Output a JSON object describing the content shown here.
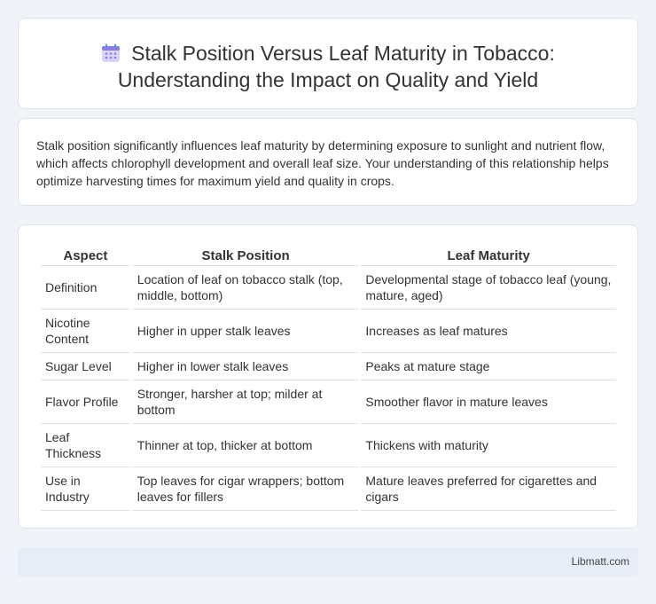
{
  "header": {
    "icon": "calendar-icon",
    "title_line1": "Stalk Position Versus Leaf Maturity in Tobacco:",
    "title_line2": "Understanding the Impact on Quality and Yield"
  },
  "intro": {
    "text": "Stalk position significantly influences leaf maturity by determining exposure to sunlight and nutrient flow, which affects chlorophyll development and overall leaf size. Your understanding of this relationship helps optimize harvesting times for maximum yield and quality in crops."
  },
  "table": {
    "headers": [
      "Aspect",
      "Stalk Position",
      "Leaf Maturity"
    ],
    "rows": [
      [
        "Definition",
        "Location of leaf on tobacco stalk (top, middle, bottom)",
        "Developmental stage of tobacco leaf (young, mature, aged)"
      ],
      [
        "Nicotine Content",
        "Higher in upper stalk leaves",
        "Increases as leaf matures"
      ],
      [
        "Sugar Level",
        "Higher in lower stalk leaves",
        "Peaks at mature stage"
      ],
      [
        "Flavor Profile",
        "Stronger, harsher at top; milder at bottom",
        "Smoother flavor in mature leaves"
      ],
      [
        "Leaf Thickness",
        "Thinner at top, thicker at bottom",
        "Thickens with maturity"
      ],
      [
        "Use in Industry",
        "Top leaves for cigar wrappers; bottom leaves for fillers",
        "Mature leaves preferred for cigarettes and cigars"
      ]
    ]
  },
  "footer": {
    "text": "Libmatt.com"
  },
  "colors": {
    "background": "#f0f4f9",
    "card": "#ffffff",
    "footer": "#e6edf7",
    "icon_accent": "#8a7fe0"
  }
}
